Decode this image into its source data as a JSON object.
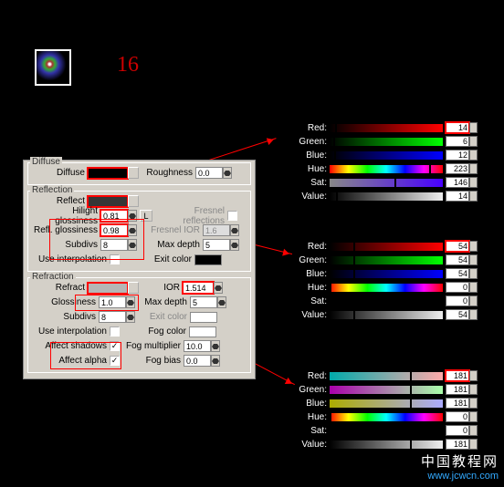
{
  "step_number": "16",
  "panel": {
    "diffuse": {
      "title": "Diffuse",
      "diffuse_lbl": "Diffuse",
      "roughness_lbl": "Roughness",
      "roughness_val": "0.0"
    },
    "reflection": {
      "title": "Reflection",
      "reflect_lbl": "Reflect",
      "hgloss_lbl": "Hilight glossiness",
      "hgloss_val": "0.81",
      "rgloss_lbl": "Refl. glossiness",
      "rgloss_val": "0.98",
      "l_btn": "L",
      "fresnel_lbl": "Fresnel reflections",
      "fior_lbl": "Fresnel IOR",
      "fior_val": "1.6",
      "subdivs_lbl": "Subdivs",
      "subdivs_val": "8",
      "maxd_lbl": "Max depth",
      "maxd_val": "5",
      "useint_lbl": "Use interpolation",
      "exitc_lbl": "Exit color"
    },
    "refraction": {
      "title": "Refraction",
      "refract_lbl": "Refract",
      "ior_lbl": "IOR",
      "ior_val": "1.514",
      "gloss_lbl": "Glossiness",
      "gloss_val": "1.0",
      "maxd_lbl": "Max depth",
      "maxd_val": "5",
      "subdivs_lbl": "Subdivs",
      "subdivs_val": "8",
      "exitc_lbl": "Exit color",
      "useint_lbl": "Use interpolation",
      "fogc_lbl": "Fog color",
      "ashadows_lbl": "Affect shadows",
      "fogm_lbl": "Fog multiplier",
      "fogm_val": "10.0",
      "aalpha_lbl": "Affect alpha",
      "fogb_lbl": "Fog bias",
      "fogb_val": "0.0"
    }
  },
  "pickers": [
    {
      "rows": [
        {
          "name": "Red:",
          "cls": "grad-r",
          "val": "14",
          "sl": 5
        },
        {
          "name": "Green:",
          "cls": "grad-g",
          "val": "6",
          "sl": 3
        },
        {
          "name": "Blue:",
          "cls": "grad-b",
          "val": "12",
          "sl": 4
        },
        {
          "name": "Hue:",
          "cls": "grad-hue",
          "val": "223",
          "sl": 88
        },
        {
          "name": "Sat:",
          "cls": "grad-sat1",
          "val": "146",
          "sl": 57
        },
        {
          "name": "Value:",
          "cls": "grad-val1",
          "val": "14",
          "sl": 6
        }
      ]
    },
    {
      "rows": [
        {
          "name": "Red:",
          "cls": "grad-r",
          "val": "54",
          "sl": 21
        },
        {
          "name": "Green:",
          "cls": "grad-g",
          "val": "54",
          "sl": 21
        },
        {
          "name": "Blue:",
          "cls": "grad-b",
          "val": "54",
          "sl": 21
        },
        {
          "name": "Hue:",
          "cls": "grad-hue",
          "val": "0",
          "sl": 0
        },
        {
          "name": "Sat:",
          "cls": "grad-sat-bk",
          "val": "0",
          "sl": 0
        },
        {
          "name": "Value:",
          "cls": "grad-val1",
          "val": "54",
          "sl": 21
        }
      ]
    },
    {
      "rows": [
        {
          "name": "Red:",
          "cls": "grad-r2",
          "val": "181",
          "sl": 71
        },
        {
          "name": "Green:",
          "cls": "grad-g2",
          "val": "181",
          "sl": 71
        },
        {
          "name": "Blue:",
          "cls": "grad-b2",
          "val": "181",
          "sl": 71
        },
        {
          "name": "Hue:",
          "cls": "grad-hue",
          "val": "0",
          "sl": 0
        },
        {
          "name": "Sat:",
          "cls": "grad-sat-bk",
          "val": "0",
          "sl": 0
        },
        {
          "name": "Value:",
          "cls": "grad-val1",
          "val": "181",
          "sl": 71
        }
      ]
    }
  ],
  "watermark": {
    "line1": "中国教程网",
    "line2": "www.jcwcn.com"
  },
  "check": "✓"
}
